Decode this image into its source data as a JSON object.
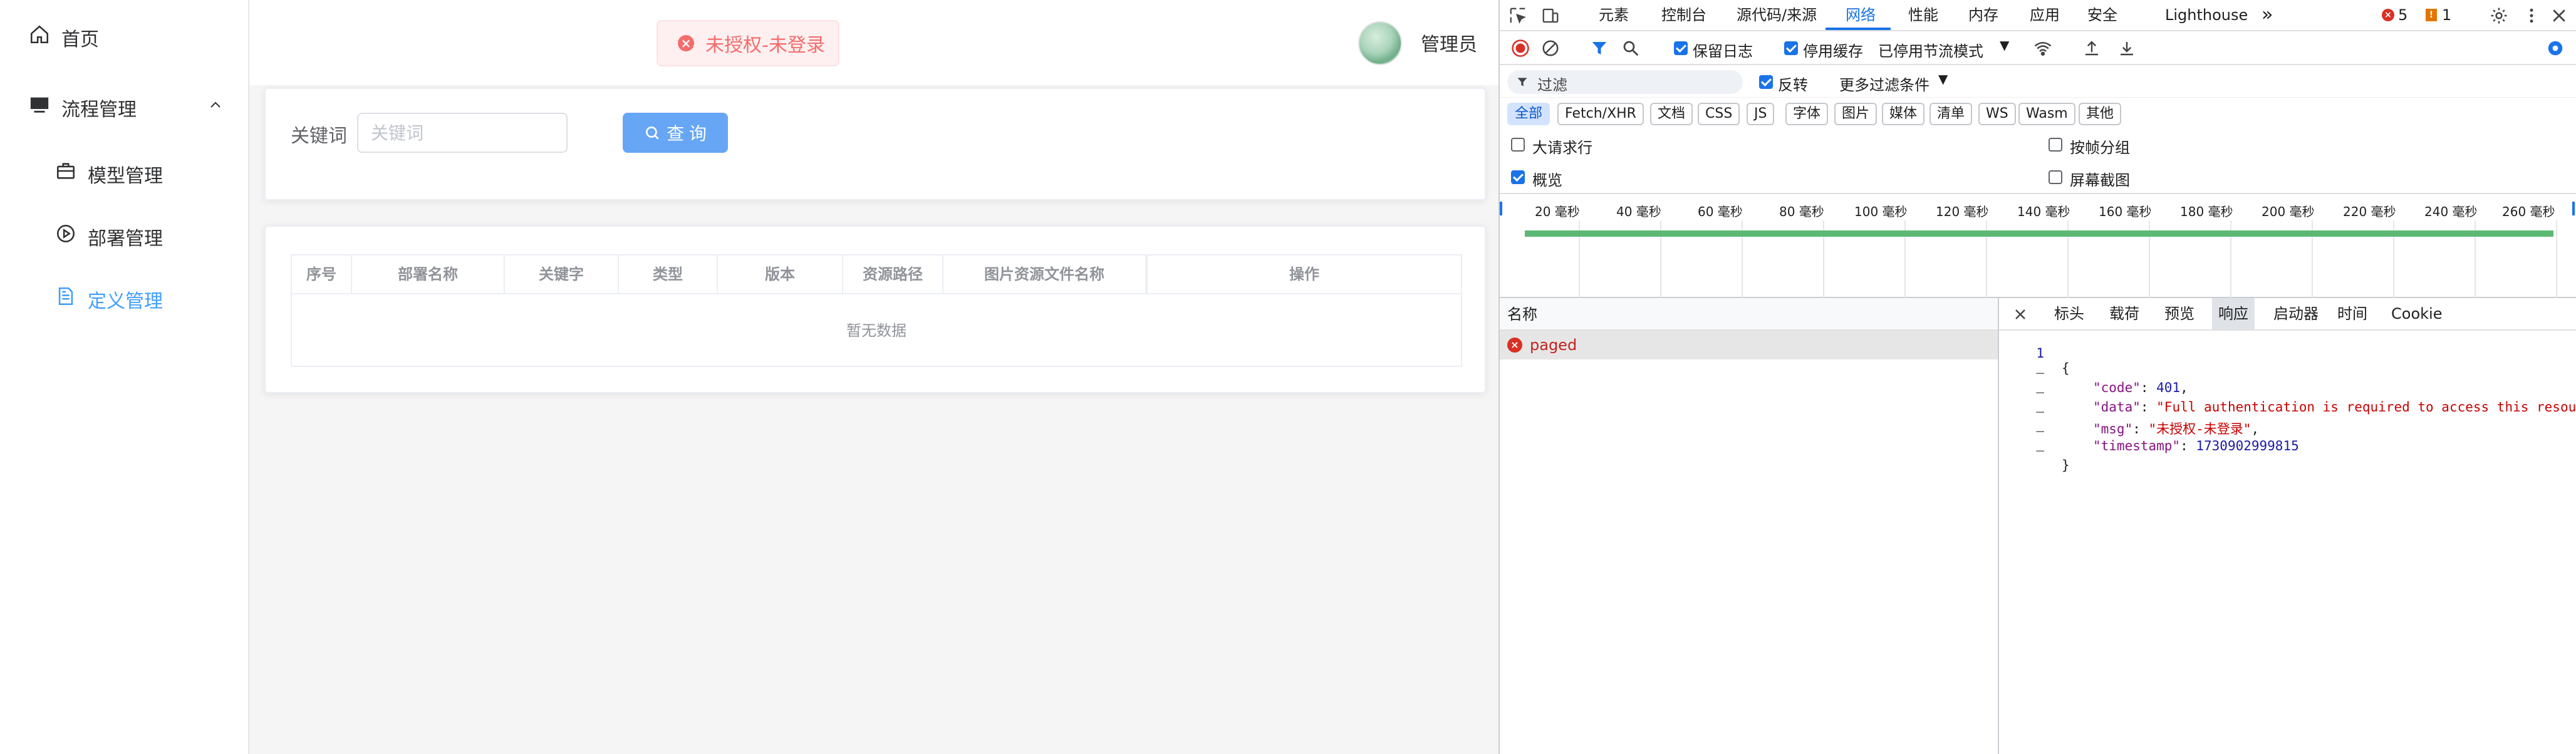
{
  "sidebar": {
    "items": [
      {
        "label": "首页"
      },
      {
        "label": "流程管理"
      },
      {
        "label": "模型管理"
      },
      {
        "label": "部署管理"
      },
      {
        "label": "定义管理"
      }
    ]
  },
  "header": {
    "toast_text": "未授权-未登录",
    "username": "管理员"
  },
  "search": {
    "keyword_label": "关键词",
    "keyword_placeholder": "关键词",
    "keyword_value": "",
    "query_button": "查 询"
  },
  "table": {
    "columns": [
      "序号",
      "部署名称",
      "关键字",
      "类型",
      "版本",
      "资源路径",
      "图片资源文件名称",
      "操作"
    ],
    "empty_text": "暂无数据"
  },
  "devtools": {
    "tabs": [
      "元素",
      "控制台",
      "源代码/来源",
      "网络",
      "性能",
      "内存",
      "应用",
      "安全",
      "Lighthouse"
    ],
    "more_tabs": "»",
    "error_count": "5",
    "warning_count": "1",
    "toolbar": {
      "preserve_log": "保留日志",
      "disable_cache": "停用缓存",
      "throttling": "已停用节流模式"
    },
    "filter": {
      "placeholder": "过滤",
      "invert": "反转",
      "more_filters": "更多过滤条件"
    },
    "type_filters": [
      "全部",
      "Fetch/XHR",
      "文档",
      "CSS",
      "JS",
      "字体",
      "图片",
      "媒体",
      "清单",
      "WS",
      "Wasm",
      "其他"
    ],
    "options": {
      "large_rows": "大请求行",
      "group_by_frame": "按帧分组",
      "overview": "概览",
      "screenshots": "屏幕截图"
    },
    "timeline_ticks": [
      "20 毫秒",
      "40 毫秒",
      "60 毫秒",
      "80 毫秒",
      "100 毫秒",
      "120 毫秒",
      "140 毫秒",
      "160 毫秒",
      "180 毫秒",
      "200 毫秒",
      "220 毫秒",
      "240 毫秒",
      "260 毫秒"
    ],
    "request_list": {
      "header": "名称",
      "rows": [
        {
          "name": "paged"
        }
      ]
    },
    "detail_tabs": [
      "标头",
      "载荷",
      "预览",
      "响应",
      "启动器",
      "时间",
      "Cookie"
    ],
    "response": {
      "line_numbers": [
        "1",
        "–",
        "–",
        "–",
        "–",
        "–"
      ],
      "open_brace": "{",
      "close_brace": "}",
      "code_key": "\"code\"",
      "code_val": "401",
      "data_key": "\"data\"",
      "data_val": "\"Full authentication is required to access this resource\"",
      "msg_key": "\"msg\"",
      "msg_val": "\"未授权-未登录\"",
      "ts_key": "\"timestamp\"",
      "ts_val": "1730902999815"
    }
  }
}
